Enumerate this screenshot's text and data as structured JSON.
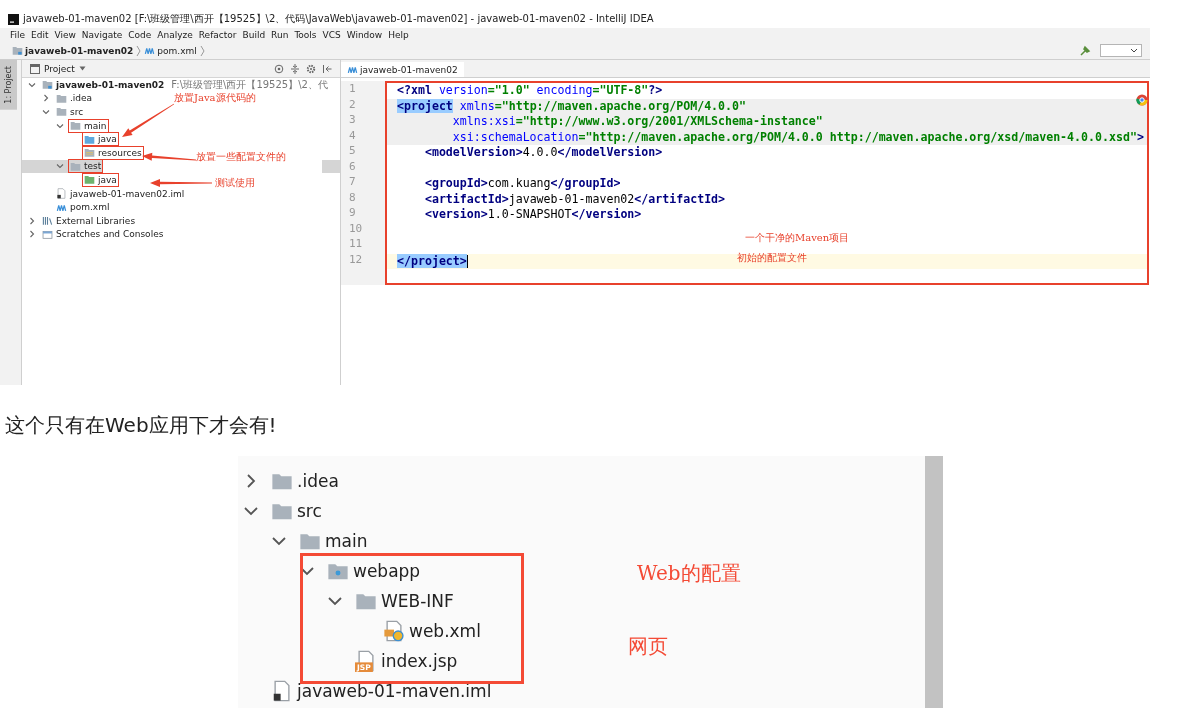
{
  "ide_window": {
    "title": "javaweb-01-maven02 [F:\\班级管理\\西开【19525】\\2、代码\\JavaWeb\\javaweb-01-maven02] - javaweb-01-maven02 - IntelliJ IDEA",
    "menu": [
      "File",
      "Edit",
      "View",
      "Navigate",
      "Code",
      "Analyze",
      "Refactor",
      "Build",
      "Run",
      "Tools",
      "VCS",
      "Window",
      "Help"
    ],
    "breadcrumb": [
      {
        "label": "javaweb-01-maven02",
        "kind": "module"
      },
      {
        "label": "pom.xml",
        "kind": "maven-file"
      }
    ],
    "tool_stripe": {
      "label": "1: Project",
      "selected": true
    },
    "project_pane": {
      "header": "Project",
      "tree": [
        {
          "name": "javaweb-01-maven02",
          "path": "F:\\班级管理\\西开【19525】\\2、代",
          "kind": "module",
          "expanded": true,
          "selected": false,
          "boxed": false,
          "children": [
            {
              "name": ".idea",
              "kind": "folder",
              "expanded": false,
              "selected": false,
              "boxed": false
            },
            {
              "name": "src",
              "kind": "folder",
              "expanded": true,
              "selected": false,
              "boxed": false,
              "children": [
                {
                  "name": "main",
                  "kind": "folder",
                  "expanded": true,
                  "selected": false,
                  "boxed": true,
                  "children": [
                    {
                      "name": "java",
                      "kind": "source-folder",
                      "selected": false,
                      "boxed": true
                    },
                    {
                      "name": "resources",
                      "kind": "resource-folder",
                      "selected": false,
                      "boxed": true
                    }
                  ]
                },
                {
                  "name": "test",
                  "kind": "folder",
                  "expanded": true,
                  "selected": true,
                  "boxed": true,
                  "children": [
                    {
                      "name": "java",
                      "kind": "test-folder",
                      "selected": false,
                      "boxed": true
                    }
                  ]
                }
              ]
            },
            {
              "name": "javaweb-01-maven02.iml",
              "kind": "iml-file",
              "selected": false,
              "boxed": false
            },
            {
              "name": "pom.xml",
              "kind": "maven-file",
              "selected": false,
              "boxed": false
            }
          ]
        },
        {
          "name": "External Libraries",
          "kind": "libraries",
          "expanded": false,
          "selected": false,
          "boxed": false
        },
        {
          "name": "Scratches and Consoles",
          "kind": "scratches",
          "expanded": false,
          "selected": false,
          "boxed": false
        }
      ]
    },
    "editor": {
      "tab": {
        "label": "javaweb-01-maven02",
        "selected": true
      },
      "boxed": true,
      "lines": [
        {
          "number": "1",
          "segments": [
            {
              "kind": "tag",
              "text": "<?xml"
            },
            {
              "kind": "attr",
              "text": " version"
            },
            {
              "kind": "str",
              "text": "=\"1.0\""
            },
            {
              "kind": "attr",
              "text": " encoding"
            },
            {
              "kind": "str",
              "text": "=\"UTF-8\""
            },
            {
              "kind": "tag",
              "text": "?>"
            }
          ]
        },
        {
          "number": "2",
          "kind": "block",
          "segments": [
            {
              "kind": "match",
              "text": "<project"
            },
            {
              "kind": "attr",
              "text": " xmlns"
            },
            {
              "kind": "str",
              "text": "=\"http://maven.apache.org/POM/4.0.0\""
            }
          ]
        },
        {
          "number": "3",
          "kind": "block",
          "segments": [
            {
              "kind": "attr",
              "text": "        xmlns:xsi"
            },
            {
              "kind": "str",
              "text": "=\"http://www.w3.org/2001/XMLSchema-instance\""
            }
          ]
        },
        {
          "number": "4",
          "kind": "block",
          "segments": [
            {
              "kind": "attr",
              "text": "        xsi:schemaLocation"
            },
            {
              "kind": "str",
              "text": "=\"http://maven.apache.org/POM/4.0.0 http://maven.apache.org/xsd/maven-4.0.0.xsd\""
            },
            {
              "kind": "tag",
              "text": ">"
            }
          ]
        },
        {
          "number": "5",
          "segments": [
            {
              "kind": "tag",
              "text": "    <modelVersion>"
            },
            {
              "kind": "text",
              "text": "4.0.0"
            },
            {
              "kind": "tag",
              "text": "</modelVersion>"
            }
          ]
        },
        {
          "number": "6"
        },
        {
          "number": "7",
          "segments": [
            {
              "kind": "tag",
              "text": "    <groupId>"
            },
            {
              "kind": "text",
              "text": "com.kuang"
            },
            {
              "kind": "tag",
              "text": "</groupId>"
            }
          ]
        },
        {
          "number": "8",
          "segments": [
            {
              "kind": "tag",
              "text": "    <artifactId>"
            },
            {
              "kind": "text",
              "text": "javaweb-01-maven02"
            },
            {
              "kind": "tag",
              "text": "</artifactId>"
            }
          ]
        },
        {
          "number": "9",
          "segments": [
            {
              "kind": "tag",
              "text": "    <version>"
            },
            {
              "kind": "text",
              "text": "1.0-SNAPSHOT"
            },
            {
              "kind": "tag",
              "text": "</version>"
            }
          ]
        },
        {
          "number": "10"
        },
        {
          "number": "11"
        },
        {
          "number": "12",
          "kind": "caret",
          "segments": [
            {
              "kind": "match",
              "text": "</project>"
            }
          ]
        }
      ]
    },
    "notes": [
      "放置Java源代码的",
      "放置一些配置文件的",
      "测试使用",
      "一个干净的Maven项目",
      "初始的配置文件"
    ]
  },
  "caption": "这个只有在Web应用下才会有!",
  "web_tree_screenshot": {
    "tree": [
      {
        "name": ".idea",
        "kind": "folder",
        "expanded": false
      },
      {
        "name": "src",
        "kind": "folder",
        "expanded": true,
        "children": [
          {
            "name": "main",
            "kind": "folder",
            "expanded": true,
            "children": [
              {
                "name": "webapp",
                "kind": "web-folder",
                "expanded": true,
                "children": [
                  {
                    "name": "WEB-INF",
                    "kind": "folder",
                    "expanded": true,
                    "children": [
                      {
                        "name": "web.xml",
                        "kind": "web-xml"
                      }
                    ]
                  },
                  {
                    "name": "index.jsp",
                    "kind": "jsp",
                    "badge": "JSP"
                  }
                ]
              }
            ]
          }
        ]
      },
      {
        "name": "javaweb-01-maven.iml",
        "kind": "iml-file"
      }
    ],
    "notes": [
      "Web的配置",
      "网页"
    ]
  }
}
